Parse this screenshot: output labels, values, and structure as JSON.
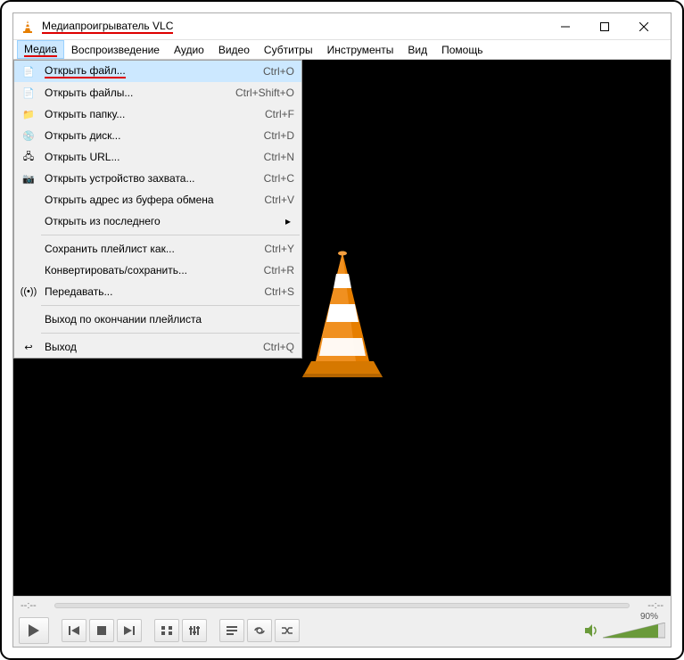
{
  "window": {
    "title": "Медиапроигрыватель VLC"
  },
  "menubar": {
    "items": [
      {
        "label": "Медиа",
        "active": true,
        "underlined": true
      },
      {
        "label": "Воспроизведение"
      },
      {
        "label": "Аудио"
      },
      {
        "label": "Видео"
      },
      {
        "label": "Субтитры"
      },
      {
        "label": "Инструменты"
      },
      {
        "label": "Вид"
      },
      {
        "label": "Помощь"
      }
    ]
  },
  "dropdown": {
    "items": [
      {
        "type": "item",
        "icon": "file-icon",
        "label": "Открыть файл...",
        "shortcut": "Ctrl+O",
        "underlined": true,
        "hover": true
      },
      {
        "type": "item",
        "icon": "files-icon",
        "label": "Открыть файлы...",
        "shortcut": "Ctrl+Shift+O"
      },
      {
        "type": "item",
        "icon": "folder-icon",
        "label": "Открыть папку...",
        "shortcut": "Ctrl+F"
      },
      {
        "type": "item",
        "icon": "disc-icon",
        "label": "Открыть диск...",
        "shortcut": "Ctrl+D"
      },
      {
        "type": "item",
        "icon": "network-icon",
        "label": "Открыть URL...",
        "shortcut": "Ctrl+N"
      },
      {
        "type": "item",
        "icon": "capture-icon",
        "label": "Открыть устройство захвата...",
        "shortcut": "Ctrl+C"
      },
      {
        "type": "item",
        "icon": "",
        "label": "Открыть адрес из буфера обмена",
        "shortcut": "Ctrl+V"
      },
      {
        "type": "item",
        "icon": "",
        "label": "Открыть из последнего",
        "shortcut": "",
        "submenu": true
      },
      {
        "type": "sep"
      },
      {
        "type": "item",
        "icon": "",
        "label": "Сохранить плейлист как...",
        "shortcut": "Ctrl+Y"
      },
      {
        "type": "item",
        "icon": "",
        "label": "Конвертировать/сохранить...",
        "shortcut": "Ctrl+R"
      },
      {
        "type": "item",
        "icon": "stream-icon",
        "label": "Передавать...",
        "shortcut": "Ctrl+S"
      },
      {
        "type": "sep"
      },
      {
        "type": "item",
        "icon": "",
        "label": "Выход по окончании плейлиста",
        "shortcut": ""
      },
      {
        "type": "sep"
      },
      {
        "type": "item",
        "icon": "exit-icon",
        "label": "Выход",
        "shortcut": "Ctrl+Q"
      }
    ]
  },
  "player": {
    "time_left": "--:--",
    "time_right": "--:--",
    "volume": "90%"
  },
  "icons": {
    "file-icon": "📄",
    "files-icon": "📄",
    "folder-icon": "📁",
    "disc-icon": "💿",
    "network-icon": "🖧",
    "capture-icon": "📷",
    "stream-icon": "((•))",
    "exit-icon": "↩"
  }
}
